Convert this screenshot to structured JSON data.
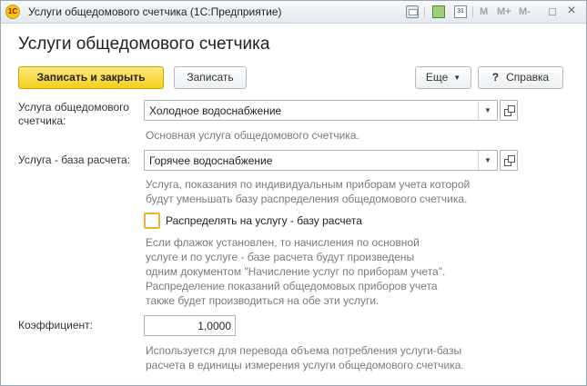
{
  "window": {
    "title": "Услуги общедомового счетчика  (1С:Предприятие)",
    "logo_text": "1С",
    "calendar_day": "31",
    "toolbar": {
      "m": "M",
      "m_plus": "M+",
      "m_minus": "M-",
      "minimize": "□",
      "close": "×"
    }
  },
  "form": {
    "title": "Услуги общедомового счетчика",
    "buttons": {
      "save_close": "Записать и закрыть",
      "save": "Записать",
      "more": "Еще",
      "help_mark": "?",
      "help": "Справка"
    },
    "fields": {
      "service": {
        "label_line1": "Услуга общедомового",
        "label_line2": "счетчика:",
        "value": "Холодное водоснабжение",
        "hint": "Основная услуга общедомового счетчика."
      },
      "base_service": {
        "label": "Услуга - база расчета:",
        "value": "Горячее водоснабжение",
        "hint_lines": [
          "Услуга, показания по индивидуальным приборам учета которой",
          "будут уменьшать базу распределения общедомового счетчика."
        ]
      },
      "distribute": {
        "label": "Распределять на услугу - базу расчета",
        "checked": false,
        "hint_lines": [
          "Если флажок установлен, то начисления по основной",
          "услуге и по услуге - базе расчета будут произведены",
          "одним документом \"Начисление услуг по приборам учета\".",
          "Распределение показаний общедомовых приборов учета",
          "также будет производиться на обе эти услуги."
        ]
      },
      "coefficient": {
        "label": "Коэффициент:",
        "value": "1,0000",
        "hint_lines": [
          "Используется для перевода объема потребления услуги-базы",
          "расчета в единицы измерения услуги общедомового счетчика."
        ]
      }
    }
  },
  "colors": {
    "accent": "#f4cf1d",
    "hint_text": "#7a7a7a",
    "checkbox_focus": "#e5b43a"
  }
}
